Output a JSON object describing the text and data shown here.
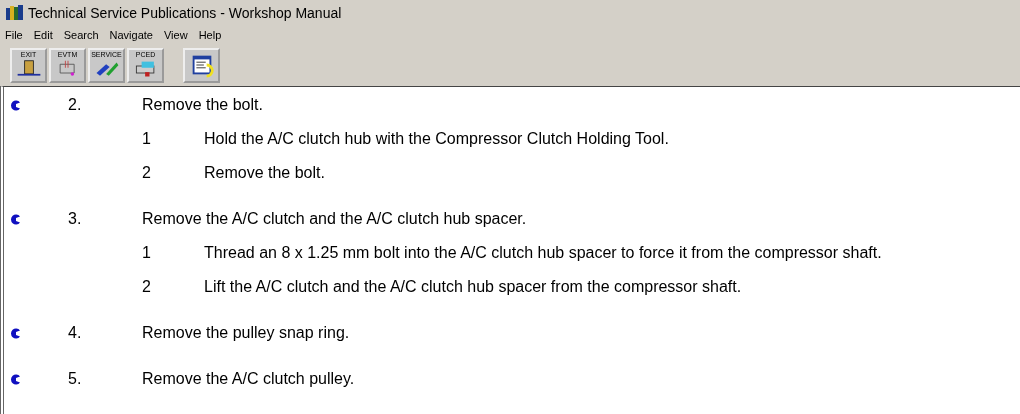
{
  "window": {
    "title": "Technical Service Publications - Workshop Manual"
  },
  "menu": [
    "File",
    "Edit",
    "Search",
    "Navigate",
    "View",
    "Help"
  ],
  "toolbar": [
    {
      "label": "EXIT",
      "kind": "exit"
    },
    {
      "label": "EVTM",
      "kind": "evtm"
    },
    {
      "label": "SERVICE",
      "kind": "service"
    },
    {
      "label": "PCED",
      "kind": "pced"
    },
    {
      "kind": "document",
      "separated": true
    }
  ],
  "steps": [
    {
      "number": "2.",
      "text": "Remove the bolt.",
      "substeps": [
        {
          "number": "1",
          "text": "Hold the A/C clutch hub with the Compressor Clutch Holding Tool."
        },
        {
          "number": "2",
          "text": "Remove the bolt."
        }
      ]
    },
    {
      "number": "3.",
      "text": "Remove the A/C clutch and the A/C clutch hub spacer.",
      "substeps": [
        {
          "number": "1",
          "text": "Thread an 8 x 1.25 mm bolt into the A/C clutch hub spacer to force it from the compressor shaft."
        },
        {
          "number": "2",
          "text": "Lift the A/C clutch and the A/C clutch hub spacer from the compressor shaft."
        }
      ]
    },
    {
      "number": "4.",
      "text": "Remove the pulley snap ring."
    },
    {
      "number": "5.",
      "text": "Remove the A/C clutch pulley."
    }
  ]
}
